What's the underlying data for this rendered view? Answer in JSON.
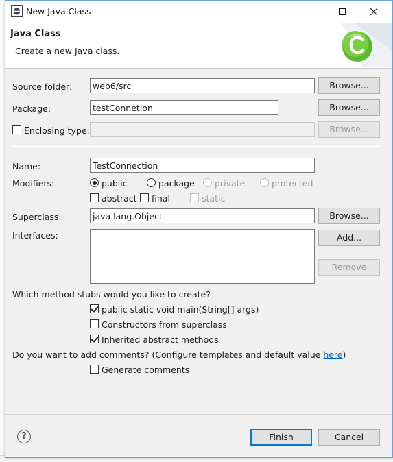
{
  "window": {
    "title": "New Java Class",
    "controls": {
      "minimize": "minimize-icon",
      "maximize": "maximize-icon",
      "close": "close-icon"
    }
  },
  "banner": {
    "title": "Java Class",
    "description": "Create a new Java class."
  },
  "form": {
    "source_folder_label": "Source folder:",
    "source_folder_value": "web6/src",
    "package_label": "Package:",
    "package_value": "testConnetion",
    "enclosing_type_label": "Enclosing type:",
    "enclosing_type_value": "",
    "browse_label": "Browse...",
    "name_label": "Name:",
    "name_value": "TestConnection",
    "modifiers_label": "Modifiers:",
    "modifiers": [
      {
        "label": "public",
        "selected": true,
        "enabled": true
      },
      {
        "label": "package",
        "selected": false,
        "enabled": true
      },
      {
        "label": "private",
        "selected": false,
        "enabled": false
      },
      {
        "label": "protected",
        "selected": false,
        "enabled": false
      }
    ],
    "modifier_flags": [
      {
        "label": "abstract",
        "checked": false,
        "enabled": true
      },
      {
        "label": "final",
        "checked": false,
        "enabled": true
      },
      {
        "label": "static",
        "checked": false,
        "enabled": false
      }
    ],
    "superclass_label": "Superclass:",
    "superclass_value": "java.lang.Object",
    "interfaces_label": "Interfaces:",
    "interfaces": [],
    "add_label": "Add...",
    "remove_label": "Remove"
  },
  "stubs": {
    "question": "Which method stubs would you like to create?",
    "options": [
      {
        "label": "public static void main(String[] args)",
        "checked": true
      },
      {
        "label": "Constructors from superclass",
        "checked": false
      },
      {
        "label": "Inherited abstract methods",
        "checked": true
      }
    ]
  },
  "comments": {
    "question_prefix": "Do you want to add comments? (Configure templates and default value ",
    "link_text": "here",
    "question_suffix": ")",
    "generate_label": "Generate comments",
    "generate_checked": false
  },
  "footer": {
    "help_icon": "help-icon",
    "finish_label": "Finish",
    "cancel_label": "Cancel"
  },
  "colors": {
    "accent": "#0078d7",
    "link": "#0066cc",
    "dialog_bg": "#f0f0f0",
    "logo_green": "#5cb82e"
  }
}
